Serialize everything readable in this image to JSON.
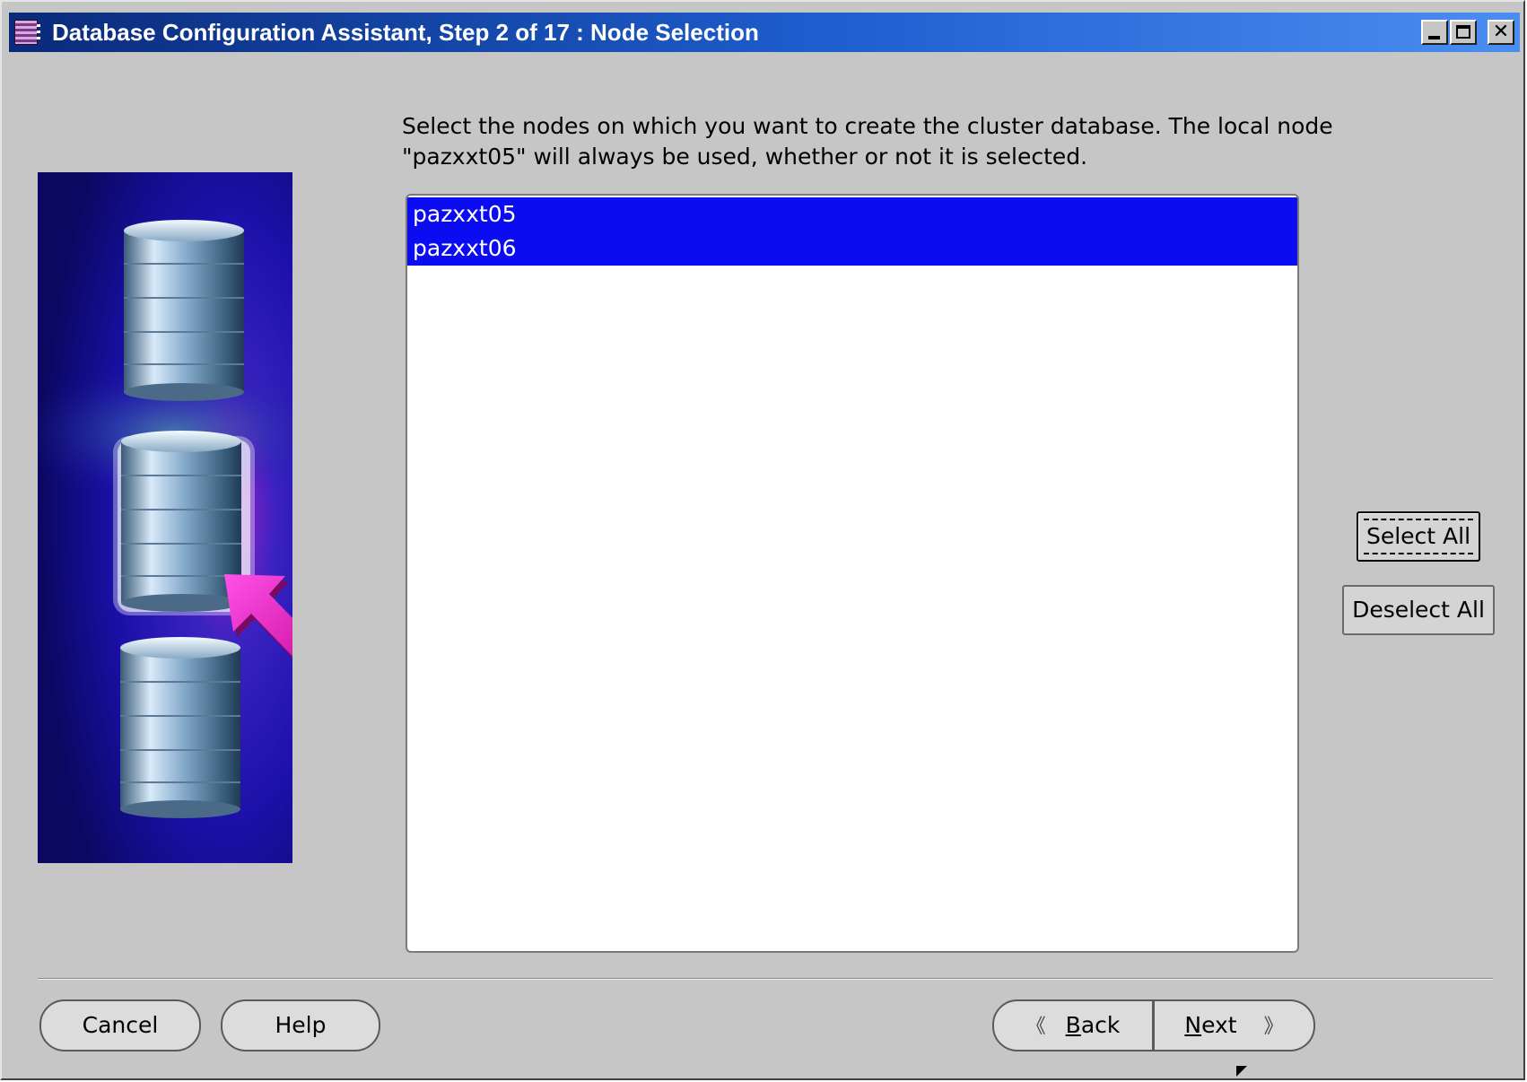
{
  "window": {
    "title": "Database Configuration Assistant, Step 2 of 17 : Node Selection",
    "controls": [
      "minimize-icon",
      "maximize-icon",
      "close-icon"
    ],
    "close_glyph": "✕"
  },
  "main": {
    "instruction_line1": "Select the nodes on which you want to create the cluster database. The local node",
    "instruction_line2": "\"pazxxt05\" will always be used, whether or not it is selected.",
    "nodes": [
      {
        "name": "pazxxt05",
        "selected": true
      },
      {
        "name": "pazxxt06",
        "selected": true
      }
    ],
    "select_all_label": "Select All",
    "deselect_all_label": "Deselect All"
  },
  "footer": {
    "cancel_label": "Cancel",
    "help_label": "Help",
    "back_arrow": "《",
    "back_mnemonic": "B",
    "back_rest": "ack",
    "next_mnemonic": "N",
    "next_rest": "ext",
    "next_arrow": "》"
  },
  "colors": {
    "selection": "#0c0cf2",
    "window_bg": "#c6c6c6",
    "titlebar_start": "#0a2a7a",
    "titlebar_end": "#4a8ef0",
    "arrow_accent": "#e020c8"
  }
}
